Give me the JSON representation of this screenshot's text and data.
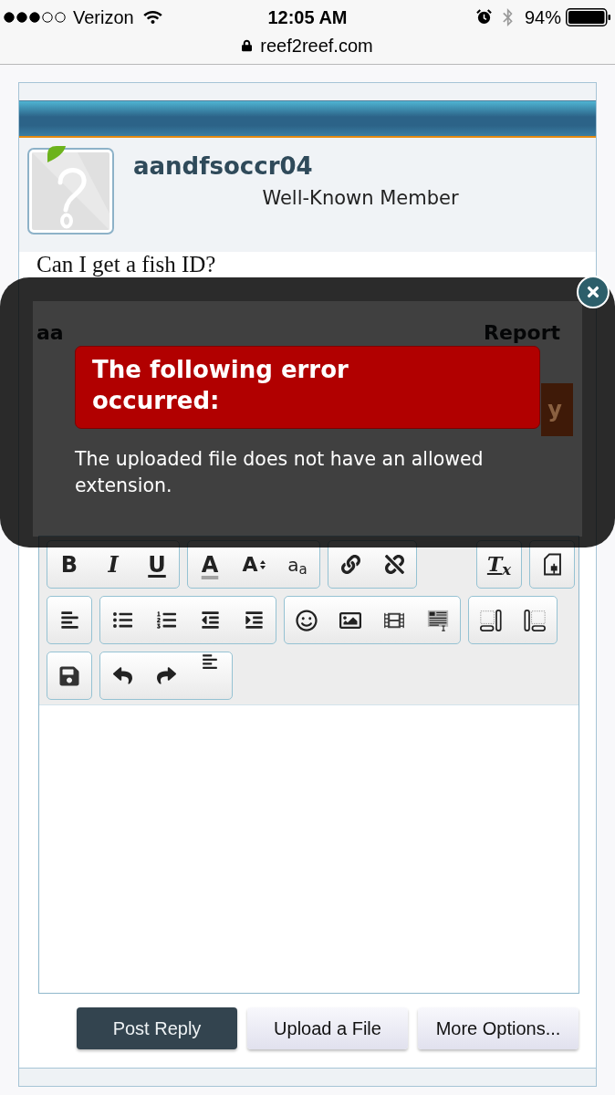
{
  "status_bar": {
    "carrier": "Verizon",
    "time": "12:05 AM",
    "battery": "94%",
    "url": "reef2reef.com"
  },
  "post": {
    "author": "aandfsoccr04",
    "user_title": "Well-Known Member",
    "message": "Can I get a fish ID?"
  },
  "dimmed_footer": {
    "author_fragment": "aa",
    "report_link": "Report",
    "reply_button_fragment": "y"
  },
  "error_dialog": {
    "title": "The following error occurred:",
    "message": "The uploaded file does not have an allowed extension."
  },
  "editor": {
    "toolbar_rows": [
      [
        [
          {
            "kind": "bold",
            "label": "B"
          },
          {
            "kind": "italic",
            "label": "I"
          },
          {
            "kind": "underline",
            "label": "U"
          }
        ],
        [
          {
            "kind": "color",
            "label": "A"
          },
          {
            "kind": "size",
            "label": "A"
          },
          {
            "kind": "family",
            "label": "a$_{a}$"
          }
        ],
        [
          {
            "kind": "link"
          },
          {
            "kind": "unlink"
          }
        ],
        [
          {
            "kind": "clear",
            "label": "T$_{x}$"
          }
        ],
        [
          {
            "kind": "paste"
          }
        ]
      ],
      [
        [
          {
            "kind": "align"
          }
        ],
        [
          {
            "kind": "bullets"
          },
          {
            "kind": "numbers"
          },
          {
            "kind": "outdent"
          },
          {
            "kind": "indent"
          }
        ],
        [
          {
            "kind": "smilies"
          },
          {
            "kind": "image"
          },
          {
            "kind": "media"
          },
          {
            "kind": "template"
          }
        ],
        [
          {
            "kind": "boxleft"
          },
          {
            "kind": "boxright"
          }
        ]
      ],
      [
        [
          {
            "kind": "save"
          }
        ],
        [
          {
            "kind": "undo"
          },
          {
            "kind": "redo"
          },
          {
            "kind": "lines"
          }
        ]
      ]
    ]
  },
  "buttons": [
    {
      "label": "Post Reply",
      "kind": "primary"
    },
    {
      "label": "Upload a File",
      "kind": "secondary"
    },
    {
      "label": "More Options...",
      "kind": "secondary"
    }
  ]
}
